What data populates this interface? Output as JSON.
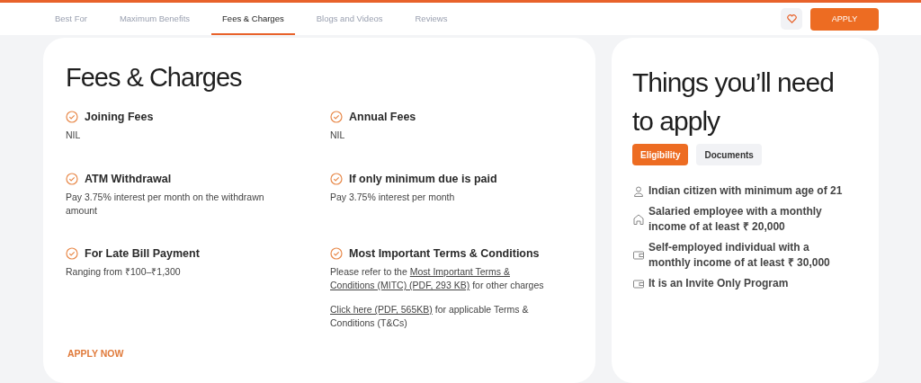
{
  "nav": {
    "tabs": [
      {
        "label": "Best For",
        "selected": false
      },
      {
        "label": "Maximum Benefits",
        "selected": false
      },
      {
        "label": "Fees & Charges",
        "selected": true
      },
      {
        "label": "Blogs and Videos",
        "selected": false
      },
      {
        "label": "Reviews",
        "selected": false
      }
    ],
    "apply_button": "APPLY"
  },
  "fees": {
    "title": "Fees & Charges",
    "items": [
      {
        "title": "Joining Fees",
        "paragraphs": [
          [
            {
              "kind": "text",
              "text": "NIL"
            }
          ]
        ]
      },
      {
        "title": "Annual Fees",
        "paragraphs": [
          [
            {
              "kind": "text",
              "text": "NIL"
            }
          ]
        ]
      },
      {
        "title": "ATM Withdrawal",
        "paragraphs": [
          [
            {
              "kind": "text",
              "text": "Pay 3.75% interest per month on the withdrawn amount"
            }
          ]
        ]
      },
      {
        "title": "If only minimum due is paid",
        "paragraphs": [
          [
            {
              "kind": "text",
              "text": "Pay 3.75% interest per month"
            }
          ]
        ]
      },
      {
        "title": "For Late Bill Payment",
        "paragraphs": [
          [
            {
              "kind": "text",
              "text": "Ranging from ₹100–₹1,300"
            }
          ]
        ]
      },
      {
        "title": "Most Important Terms & Conditions",
        "paragraphs": [
          [
            {
              "kind": "text",
              "text": "Please refer to the "
            },
            {
              "kind": "link",
              "text": "Most Important Terms &"
            },
            {
              "kind": "link",
              "text": "Conditions (MITC) (PDF, 293 KB)"
            },
            {
              "kind": "text",
              "text": " for other charges"
            }
          ],
          [
            {
              "kind": "link",
              "text": "Click here (PDF, 565KB)"
            },
            {
              "kind": "text",
              "text": " for applicable Terms &"
            },
            {
              "kind": "text",
              "text": "Conditions (T&Cs)"
            }
          ]
        ]
      }
    ],
    "apply_now": "APPLY NOW"
  },
  "requirements": {
    "title": "Things you’ll need to apply",
    "tabs": [
      {
        "label": "Eligibility",
        "selected": true
      },
      {
        "label": "Documents",
        "selected": false
      }
    ],
    "items": [
      {
        "kind": "person",
        "text": "Indian citizen with minimum age of 21"
      },
      {
        "kind": "house",
        "text": "Salaried employee with a monthly income of at least ₹ 20,000"
      },
      {
        "kind": "wallet",
        "text": "Self-employed individual with a monthly income of at least ₹ 30,000"
      },
      {
        "kind": "wallet",
        "text": "It is an Invite Only Program"
      }
    ]
  }
}
